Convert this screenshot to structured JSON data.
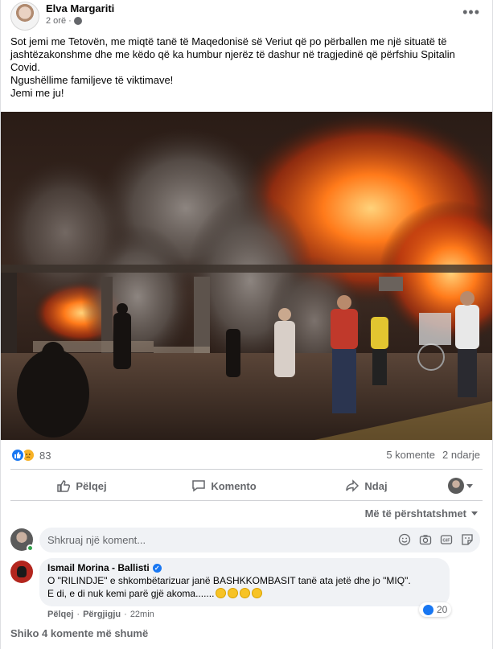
{
  "post": {
    "author": "Elva Margariti",
    "time": "2 orë ·",
    "text_lines": [
      "Sot jemi me Tetovën, me miqtë tanë të Maqedonisë së Veriut që po përballen me një situatë të jashtëzakonshme dhe me këdo që ka humbur njerëz të dashur në tragjedinë që përfshiu Spitalin Covid.",
      "Ngushëllime familjeve të viktimave!",
      "Jemi me ju!"
    ]
  },
  "reactions": {
    "count": "83",
    "comments": "5 komente",
    "shares": "2 ndarje"
  },
  "actions": {
    "like": "Pëlqej",
    "comment": "Komento",
    "share": "Ndaj"
  },
  "sort_label": "Më të përshtatshmet",
  "composer": {
    "placeholder": "Shkruaj një koment..."
  },
  "comment": {
    "author": "Ismail Morina - Ballisti",
    "line1": "O \"RILINDJE\" e shkombëtarizuar janë BASHKKOMBASIT tanë ata jetë dhe jo \"MIQ\".",
    "line2": "E di, e di nuk kemi parë gjë akoma.......",
    "likes": "20",
    "like_action": "Pëlqej",
    "reply_action": "Përgjigju",
    "time": "22min"
  },
  "more_comments": "Shiko 4 komente më shumë",
  "colors": {
    "accent": "#1877f2",
    "muted_text": "#65676b",
    "bubble_bg": "#f0f2f5",
    "fire": "#ff6a00"
  }
}
